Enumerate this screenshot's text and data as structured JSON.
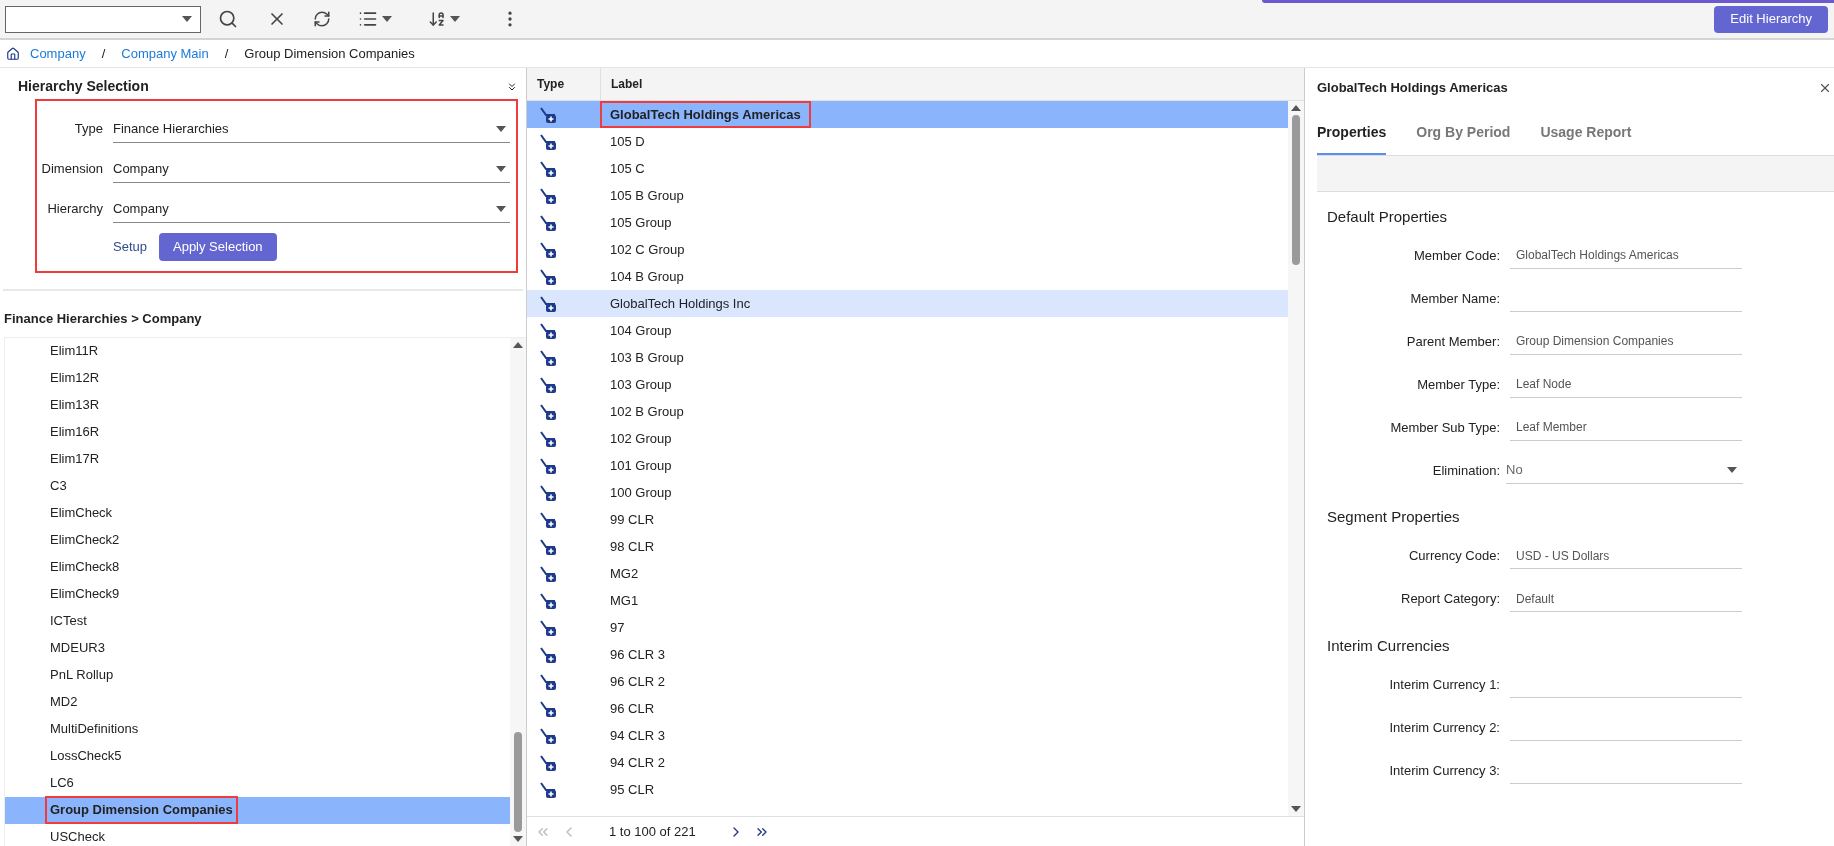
{
  "toolbar": {
    "action_button": "Edit Hierarchy"
  },
  "breadcrumb": [
    {
      "kind": "link",
      "label": "Company"
    },
    {
      "kind": "separator",
      "label": "/"
    },
    {
      "kind": "link",
      "label": "Company Main"
    },
    {
      "kind": "separator",
      "label": "/"
    },
    {
      "kind": "current",
      "label": "Group Dimension Companies"
    }
  ],
  "hierarchy_selection": {
    "title": "Hierarchy Selection",
    "annotated": true,
    "fields": [
      {
        "label": "Type",
        "value": "Finance Hierarchies"
      },
      {
        "label": "Dimension",
        "value": "Company"
      },
      {
        "label": "Hierarchy",
        "value": "Company"
      }
    ],
    "setup_link": "Setup",
    "apply_button": "Apply Selection"
  },
  "tree": {
    "path": "Finance Hierarchies > Company",
    "items": [
      {
        "label": "Elim11R",
        "selected": false,
        "annotated": false
      },
      {
        "label": "Elim12R",
        "selected": false,
        "annotated": false
      },
      {
        "label": "Elim13R",
        "selected": false,
        "annotated": false
      },
      {
        "label": "Elim16R",
        "selected": false,
        "annotated": false
      },
      {
        "label": "Elim17R",
        "selected": false,
        "annotated": false
      },
      {
        "label": "C3",
        "selected": false,
        "annotated": false
      },
      {
        "label": "ElimCheck",
        "selected": false,
        "annotated": false
      },
      {
        "label": "ElimCheck2",
        "selected": false,
        "annotated": false
      },
      {
        "label": "ElimCheck8",
        "selected": false,
        "annotated": false
      },
      {
        "label": "ElimCheck9",
        "selected": false,
        "annotated": false
      },
      {
        "label": "ICTest",
        "selected": false,
        "annotated": false
      },
      {
        "label": "MDEUR3",
        "selected": false,
        "annotated": false
      },
      {
        "label": "PnL Rollup",
        "selected": false,
        "annotated": false
      },
      {
        "label": "MD2",
        "selected": false,
        "annotated": false
      },
      {
        "label": "MultiDefinitions",
        "selected": false,
        "annotated": false
      },
      {
        "label": "LossCheck5",
        "selected": false,
        "annotated": false
      },
      {
        "label": "LC6",
        "selected": false,
        "annotated": false
      },
      {
        "label": "Group Dimension Companies",
        "selected": true,
        "annotated": true
      },
      {
        "label": "USCheck",
        "selected": false,
        "annotated": false
      }
    ]
  },
  "grid": {
    "columns": [
      "Type",
      "Label"
    ],
    "rows": [
      {
        "label": "GlobalTech Holdings Americas",
        "selected": true,
        "hovered": false,
        "annotated": true
      },
      {
        "label": "105 D",
        "selected": false,
        "hovered": false,
        "annotated": false
      },
      {
        "label": "105 C",
        "selected": false,
        "hovered": false,
        "annotated": false
      },
      {
        "label": "105 B Group",
        "selected": false,
        "hovered": false,
        "annotated": false
      },
      {
        "label": "105 Group",
        "selected": false,
        "hovered": false,
        "annotated": false
      },
      {
        "label": "102 C Group",
        "selected": false,
        "hovered": false,
        "annotated": false
      },
      {
        "label": "104 B Group",
        "selected": false,
        "hovered": false,
        "annotated": false
      },
      {
        "label": "GlobalTech Holdings Inc",
        "selected": false,
        "hovered": true,
        "annotated": false
      },
      {
        "label": "104 Group",
        "selected": false,
        "hovered": false,
        "annotated": false
      },
      {
        "label": "103 B Group",
        "selected": false,
        "hovered": false,
        "annotated": false
      },
      {
        "label": "103 Group",
        "selected": false,
        "hovered": false,
        "annotated": false
      },
      {
        "label": "102 B Group",
        "selected": false,
        "hovered": false,
        "annotated": false
      },
      {
        "label": "102 Group",
        "selected": false,
        "hovered": false,
        "annotated": false
      },
      {
        "label": "101 Group",
        "selected": false,
        "hovered": false,
        "annotated": false
      },
      {
        "label": "100 Group",
        "selected": false,
        "hovered": false,
        "annotated": false
      },
      {
        "label": "99 CLR",
        "selected": false,
        "hovered": false,
        "annotated": false
      },
      {
        "label": "98 CLR",
        "selected": false,
        "hovered": false,
        "annotated": false
      },
      {
        "label": "MG2",
        "selected": false,
        "hovered": false,
        "annotated": false
      },
      {
        "label": "MG1",
        "selected": false,
        "hovered": false,
        "annotated": false
      },
      {
        "label": "97",
        "selected": false,
        "hovered": false,
        "annotated": false
      },
      {
        "label": "96 CLR 3",
        "selected": false,
        "hovered": false,
        "annotated": false
      },
      {
        "label": "96 CLR 2",
        "selected": false,
        "hovered": false,
        "annotated": false
      },
      {
        "label": "96 CLR",
        "selected": false,
        "hovered": false,
        "annotated": false
      },
      {
        "label": "94 CLR 3",
        "selected": false,
        "hovered": false,
        "annotated": false
      },
      {
        "label": "94 CLR 2",
        "selected": false,
        "hovered": false,
        "annotated": false
      },
      {
        "label": "95 CLR",
        "selected": false,
        "hovered": false,
        "annotated": false
      }
    ],
    "pager": {
      "range": "1 to 100 of 221",
      "back_disabled": true,
      "forward_disabled": false
    }
  },
  "details": {
    "title": "GlobalTech Holdings Americas",
    "tabs": [
      {
        "label": "Properties",
        "selected": true
      },
      {
        "label": "Org By Period",
        "selected": false
      },
      {
        "label": "Usage Report",
        "selected": false
      }
    ],
    "sections": [
      {
        "title": "Default Properties",
        "fields": [
          {
            "kind": "text",
            "label": "Member Code:",
            "value": "GlobalTech Holdings Americas"
          },
          {
            "kind": "text",
            "label": "Member Name:"
          },
          {
            "kind": "text",
            "label": "Parent Member:",
            "value": "Group Dimension Companies"
          },
          {
            "kind": "text",
            "label": "Member Type:",
            "value": "Leaf Node"
          },
          {
            "kind": "text",
            "label": "Member Sub Type:",
            "value": "Leaf Member"
          },
          {
            "kind": "select",
            "label": "Elimination:",
            "value": "No"
          }
        ]
      },
      {
        "title": "Segment Properties",
        "fields": [
          {
            "kind": "text",
            "label": "Currency Code:",
            "value": "USD - US Dollars"
          },
          {
            "kind": "text",
            "label": "Report Category:",
            "value": "Default"
          }
        ]
      },
      {
        "title": "Interim Currencies",
        "fields": [
          {
            "kind": "text",
            "label": "Interim Currency 1:"
          },
          {
            "kind": "text",
            "label": "Interim Currency 2:"
          },
          {
            "kind": "text",
            "label": "Interim Currency 3:"
          }
        ]
      }
    ]
  }
}
